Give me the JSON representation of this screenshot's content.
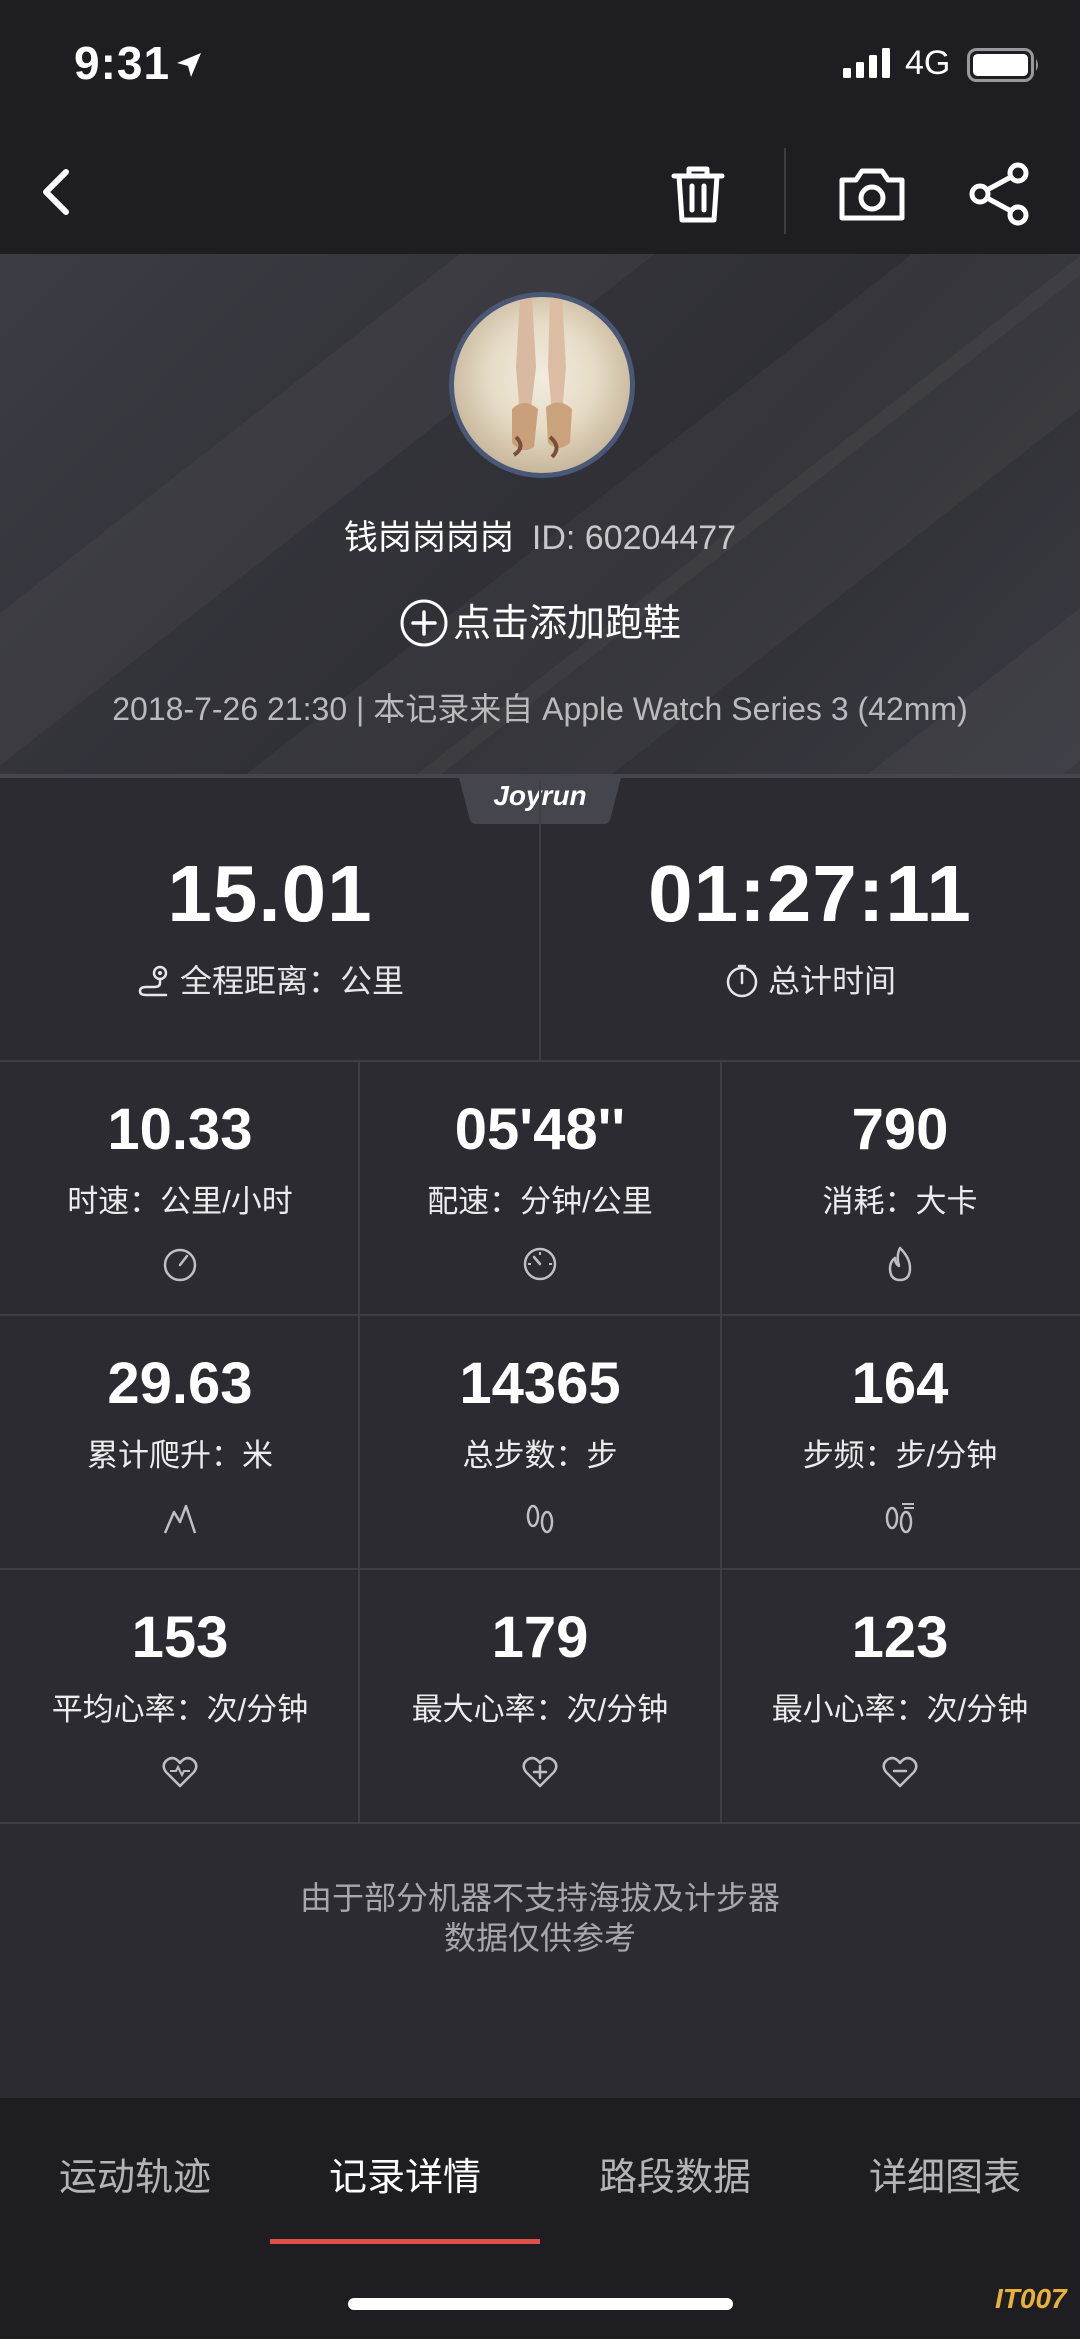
{
  "status_bar": {
    "time": "9:31",
    "network": "4G"
  },
  "nav": {
    "back_icon": "chevron-left-icon",
    "actions": [
      "trash-icon",
      "camera-icon",
      "share-icon"
    ]
  },
  "profile": {
    "name": "钱岗岗岗岗",
    "id_text": "ID: 60204477",
    "add_shoe": "点击添加跑鞋",
    "record_info": "2018-7-26 21:30 | 本记录来自 Apple Watch Series 3 (42mm)"
  },
  "joyrun_label": "Joyrun",
  "summary": {
    "distance": {
      "value": "15.01",
      "label": "全程距离：公里"
    },
    "time": {
      "value": "01:27:11",
      "label": "总计时间"
    }
  },
  "metrics": [
    {
      "value": "10.33",
      "label": "时速：公里/小时",
      "icon": "speedometer-icon"
    },
    {
      "value": "05'48''",
      "label": "配速：分钟/公里",
      "icon": "pace-dial-icon"
    },
    {
      "value": "790",
      "label": "消耗：大卡",
      "icon": "flame-icon"
    },
    {
      "value": "29.63",
      "label": "累计爬升：米",
      "icon": "mountain-icon"
    },
    {
      "value": "14365",
      "label": "总步数：步",
      "icon": "footprints-icon"
    },
    {
      "value": "164",
      "label": "步频：步/分钟",
      "icon": "cadence-icon"
    },
    {
      "value": "153",
      "label": "平均心率：次/分钟",
      "icon": "heart-avg-icon"
    },
    {
      "value": "179",
      "label": "最大心率：次/分钟",
      "icon": "heart-max-icon"
    },
    {
      "value": "123",
      "label": "最小心率：次/分钟",
      "icon": "heart-min-icon"
    }
  ],
  "note": {
    "line1": "由于部分机器不支持海拔及计步器",
    "line2": "数据仅供参考"
  },
  "tabs": [
    {
      "label": "运动轨迹",
      "active": false
    },
    {
      "label": "记录详情",
      "active": true
    },
    {
      "label": "路段数据",
      "active": false
    },
    {
      "label": "详细图表",
      "active": false
    }
  ],
  "watermark": "IT007",
  "colors": {
    "accent": "#e0504a",
    "background": "#2b2b31",
    "bar": "#1d1d22"
  }
}
